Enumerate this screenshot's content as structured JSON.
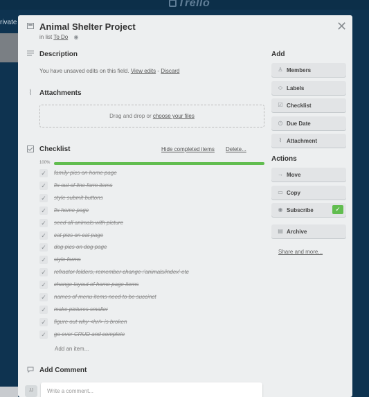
{
  "background": {
    "logo_text": "Trello",
    "private_label": "rivate"
  },
  "card": {
    "title": "Animal Shelter Project",
    "in_list_prefix": "in list",
    "list_name": "To Do"
  },
  "description": {
    "heading": "Description",
    "unsaved_text": "You have unsaved edits on this field.",
    "view_edits": "View edits",
    "separator": "-",
    "discard": "Discard"
  },
  "attachments": {
    "heading": "Attachments",
    "drop_text": "Drag and drop or",
    "choose_files": "choose your files"
  },
  "checklist": {
    "heading": "Checklist",
    "hide_completed": "Hide completed items",
    "delete": "Delete...",
    "progress_label": "100%",
    "progress_value": 1.0,
    "add_item": "Add an item...",
    "items": [
      {
        "text": "family pics on home page",
        "done": true
      },
      {
        "text": "fix out of line form items",
        "done": true
      },
      {
        "text": "style submit buttons",
        "done": true
      },
      {
        "text": "fix home page",
        "done": true
      },
      {
        "text": "seed all animals with picture",
        "done": true
      },
      {
        "text": "cat pics on cat page",
        "done": true
      },
      {
        "text": "dog pics on dog page",
        "done": true
      },
      {
        "text": "style forms",
        "done": true
      },
      {
        "text": "refractor folders, remember change :'animals/index' etc",
        "done": true
      },
      {
        "text": "change layout of home page items",
        "done": true
      },
      {
        "text": "names of menu items need to be succinct",
        "done": true
      },
      {
        "text": "make pictures smaller",
        "done": true
      },
      {
        "text": "figure out why <hr/> is broken",
        "done": true
      },
      {
        "text": "go over CRUD and complete",
        "done": true
      }
    ]
  },
  "comment": {
    "heading": "Add Comment",
    "placeholder": "Write a comment...",
    "avatar_initials": "JJ"
  },
  "sidebar": {
    "add_heading": "Add",
    "add_buttons": [
      {
        "label": "Members",
        "icon": "person-icon"
      },
      {
        "label": "Labels",
        "icon": "tag-icon"
      },
      {
        "label": "Checklist",
        "icon": "checkbox-icon"
      },
      {
        "label": "Due Date",
        "icon": "clock-icon"
      },
      {
        "label": "Attachment",
        "icon": "paperclip-icon"
      }
    ],
    "actions_heading": "Actions",
    "action_buttons": [
      {
        "label": "Move",
        "icon": "arrow-right-icon"
      },
      {
        "label": "Copy",
        "icon": "card-icon"
      },
      {
        "label": "Subscribe",
        "icon": "eye-icon",
        "checked": true
      },
      {
        "label": "Archive",
        "icon": "archive-icon"
      }
    ],
    "share_more": "Share and more..."
  },
  "colors": {
    "board_bg": "#0f3552",
    "modal_bg": "#edeff0",
    "progress_green": "#61bd4f"
  }
}
